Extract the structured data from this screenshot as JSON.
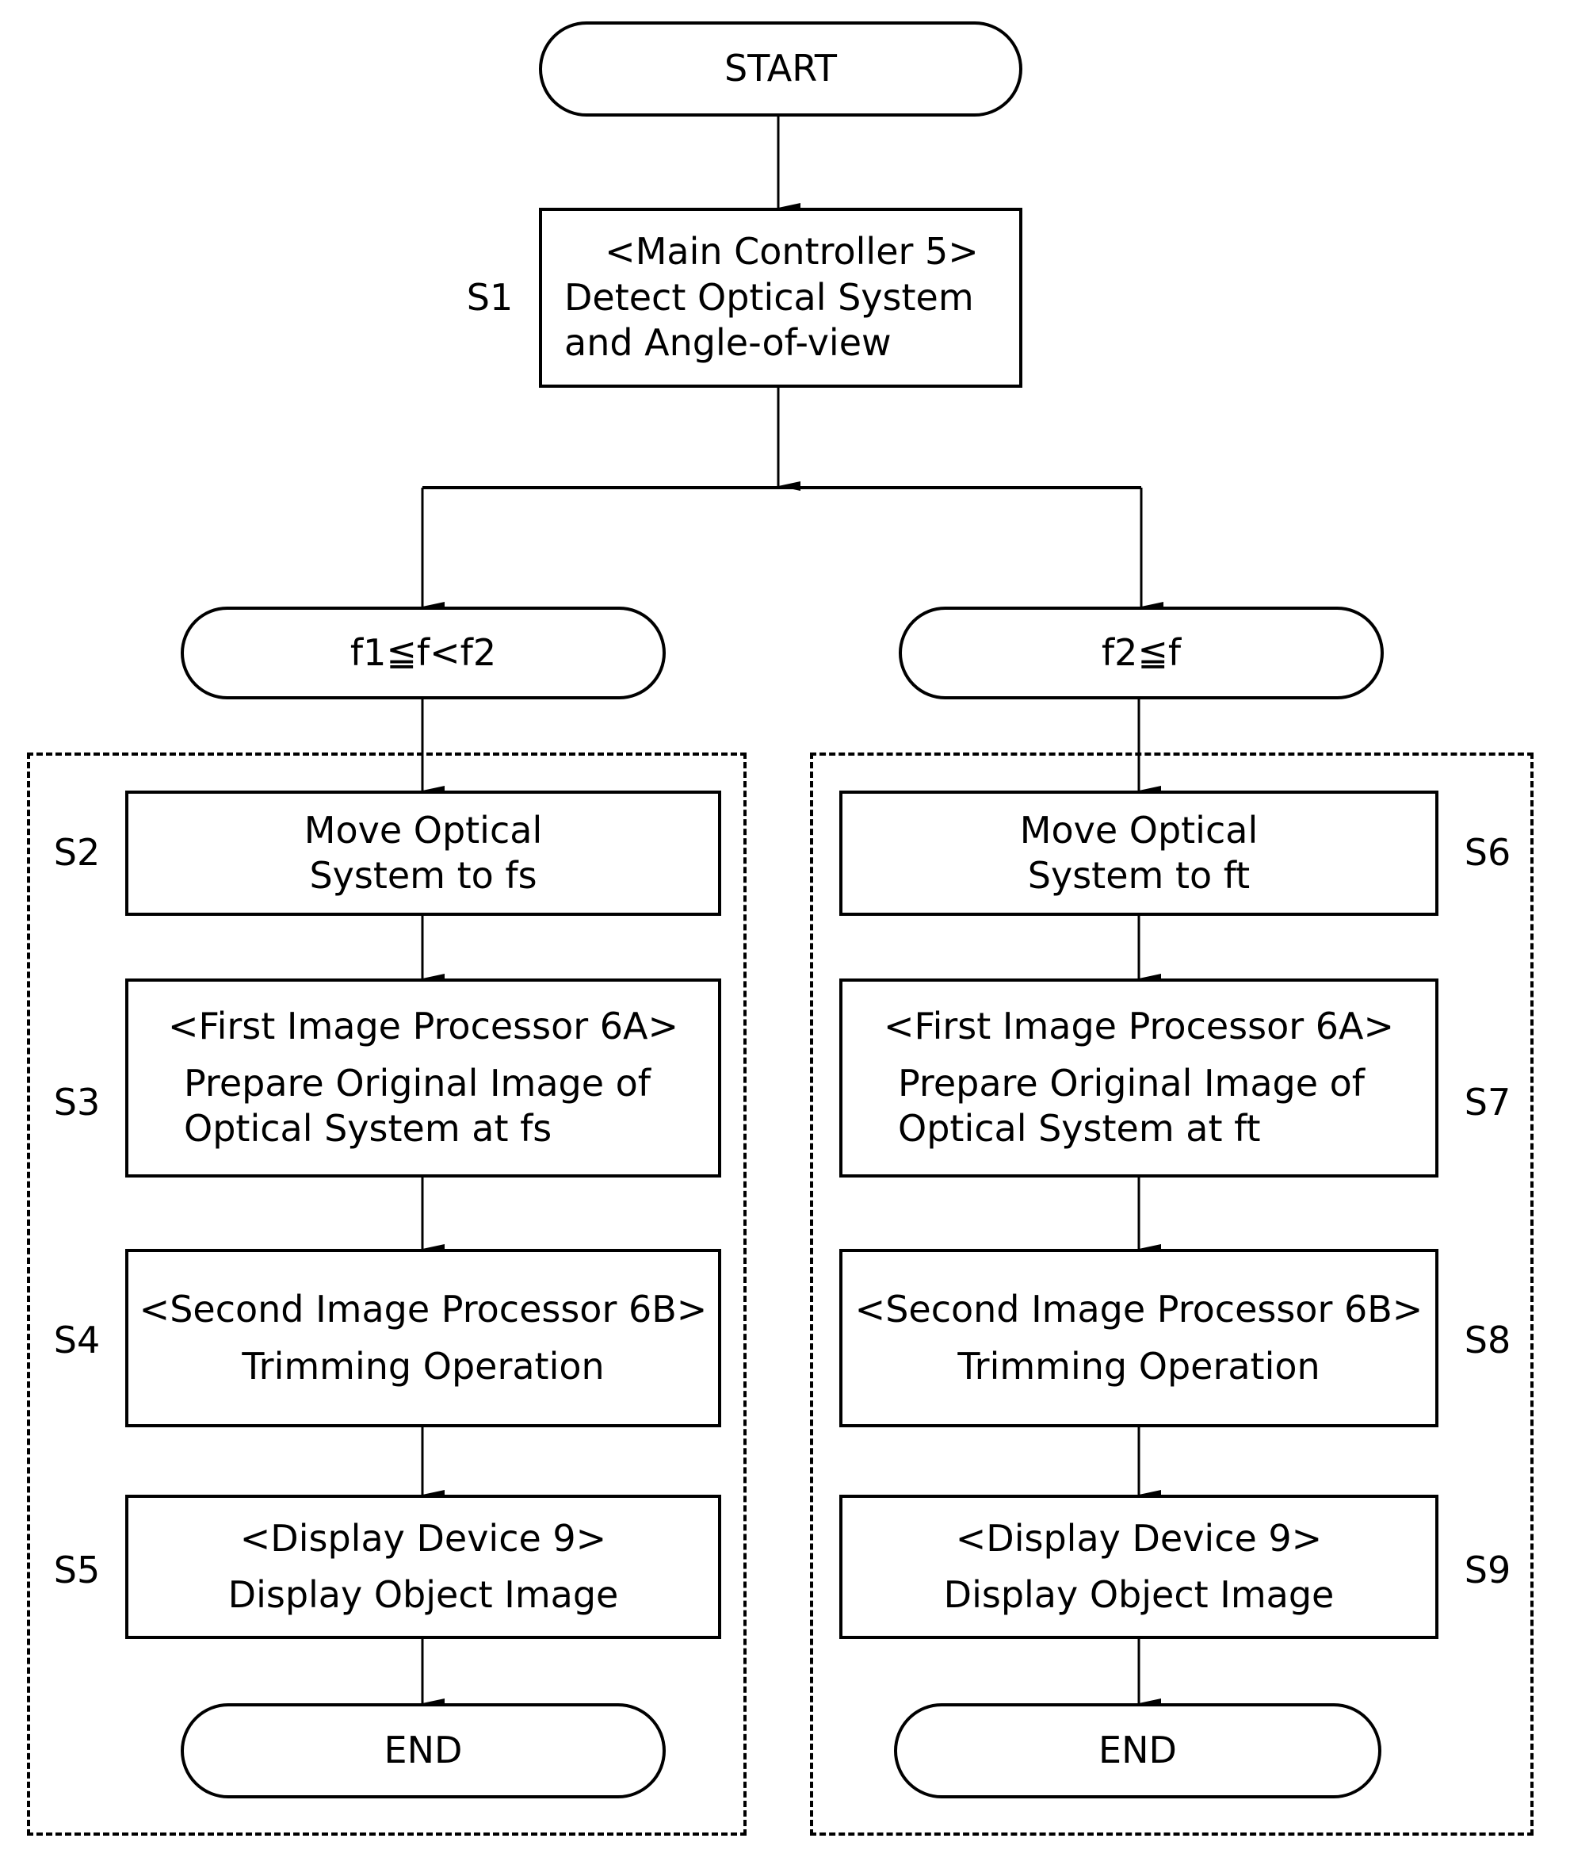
{
  "start": {
    "label": "START"
  },
  "s1": {
    "step": "S1",
    "lines": [
      "<Main Controller 5>",
      "Detect Optical System",
      "and Angle-of-view"
    ]
  },
  "branches": [
    {
      "condition": "f1≦f<f2",
      "steps": [
        {
          "step": "S2",
          "lines": [
            "Move Optical",
            "System to fs"
          ]
        },
        {
          "step": "S3",
          "lines": [
            "<First Image Processor 6A>",
            "Prepare Original Image of",
            "Optical System at fs"
          ]
        },
        {
          "step": "S4",
          "lines": [
            "<Second Image Processor 6B>",
            "Trimming Operation"
          ]
        },
        {
          "step": "S5",
          "lines": [
            "<Display Device 9>",
            "Display Object Image"
          ]
        }
      ],
      "end": "END"
    },
    {
      "condition": "f2≦f",
      "steps": [
        {
          "step": "S6",
          "lines": [
            "Move Optical",
            "System to ft"
          ]
        },
        {
          "step": "S7",
          "lines": [
            "<First Image Processor 6A>",
            "Prepare Original Image of",
            "Optical System at ft"
          ]
        },
        {
          "step": "S8",
          "lines": [
            "<Second Image Processor 6B>",
            "Trimming Operation"
          ]
        },
        {
          "step": "S9",
          "lines": [
            "<Display Device 9>",
            "Display Object Image"
          ]
        }
      ],
      "end": "END"
    }
  ]
}
